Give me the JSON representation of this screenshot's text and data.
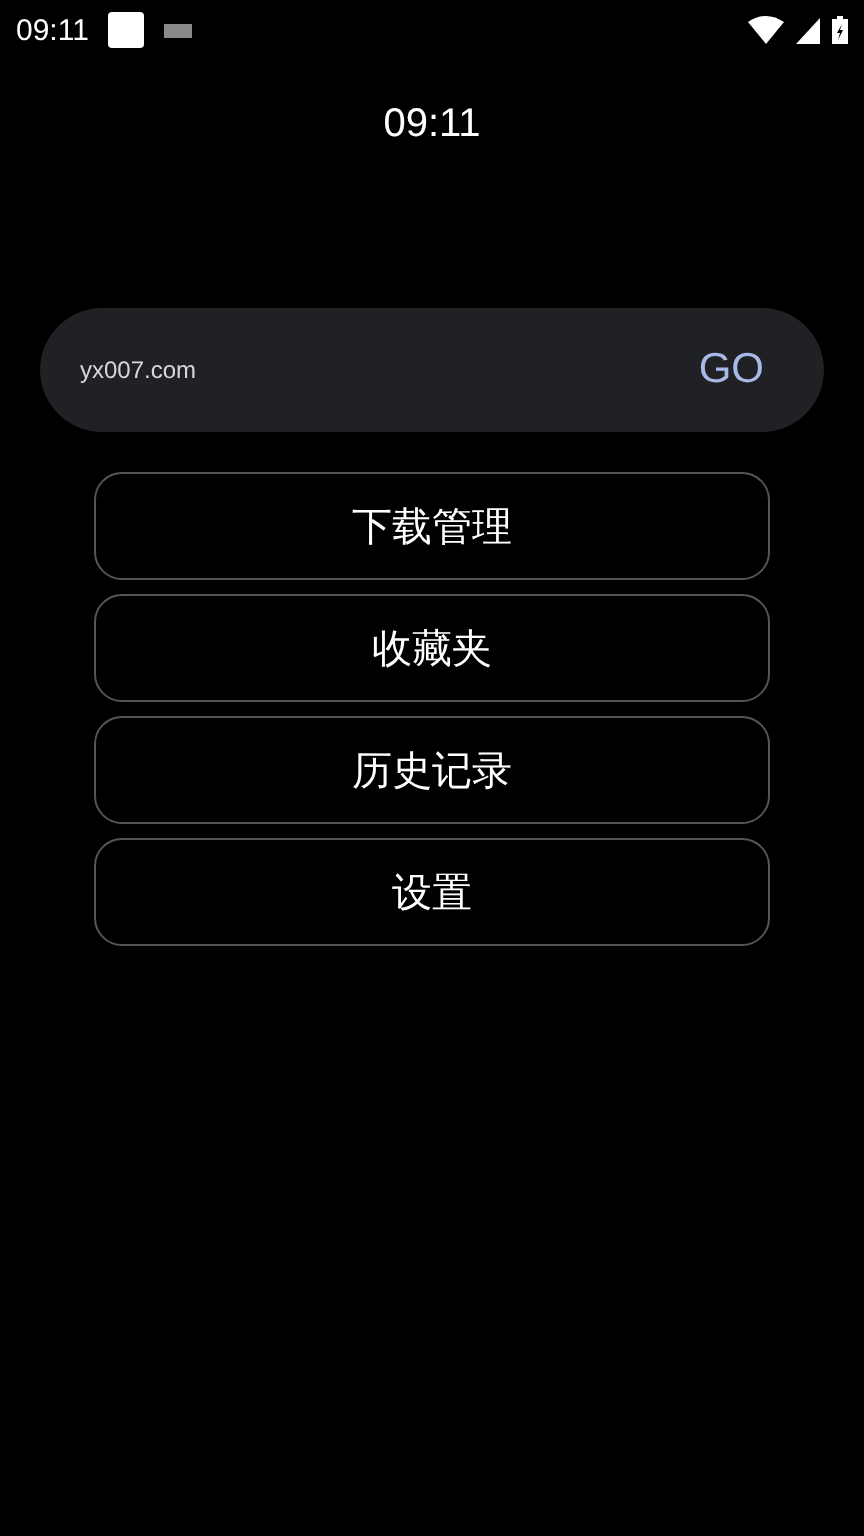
{
  "status_bar": {
    "time": "09:11"
  },
  "clock": "09:11",
  "address_bar": {
    "value": "yx007.com",
    "go_label": "GO"
  },
  "menu": [
    {
      "label": "下载管理"
    },
    {
      "label": "收藏夹"
    },
    {
      "label": "历史记录"
    },
    {
      "label": "设置"
    }
  ]
}
